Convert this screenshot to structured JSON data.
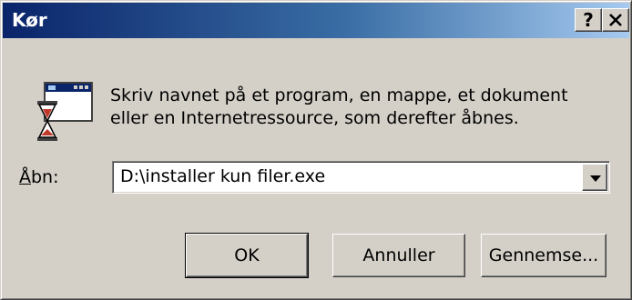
{
  "window": {
    "title": "Kør",
    "help_label": "?",
    "close_label": "×"
  },
  "icon": {
    "name": "run-program-icon"
  },
  "description": {
    "line1": "Skriv navnet på et program, en mappe, et dokument",
    "line2": "eller en Internetressource, som derefter åbnes."
  },
  "open_field": {
    "label_prefix": "Å",
    "label_rest": "bn:",
    "value": "D:\\installer kun filer.exe"
  },
  "buttons": {
    "ok": "OK",
    "cancel": "Annuller",
    "browse": "Gennemse..."
  },
  "colors": {
    "face": "#d4d0c8",
    "title_start": "#0a246a",
    "title_end": "#a6caf0"
  }
}
